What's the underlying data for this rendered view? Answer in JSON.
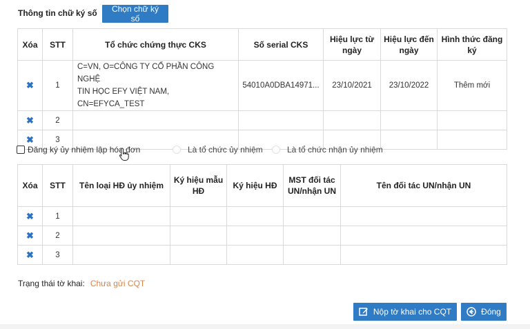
{
  "signature_section": {
    "title": "Thông tin chữ ký số",
    "choose_button": "Chọn chữ ký số",
    "headers": [
      "Xóa",
      "STT",
      "Tổ chức chứng thực CKS",
      "Số serial CKS",
      "Hiệu lực từ ngày",
      "Hiệu lực đến ngày",
      "Hình thức đăng ký"
    ],
    "rows": [
      {
        "stt": "1",
        "org_line1": "C=VN, O=CÔNG TY CỔ PHẦN CÔNG NGHỆ",
        "org_line2": "TIN HỌC EFY VIỆT NAM, CN=EFYCA_TEST",
        "serial": "54010A0DBA14971...",
        "from": "23/10/2021",
        "to": "23/10/2022",
        "type": "Thêm mới"
      },
      {
        "stt": "2",
        "org_line1": "",
        "org_line2": "",
        "serial": "",
        "from": "",
        "to": "",
        "type": ""
      },
      {
        "stt": "3",
        "org_line1": "",
        "org_line2": "",
        "serial": "",
        "from": "",
        "to": "",
        "type": ""
      }
    ]
  },
  "options": {
    "checkbox_label": "Đăng ký ủy nhiệm lập hóa đơn",
    "radio_1": "Là tổ chức ủy nhiệm",
    "radio_2": "Là tổ chức nhận ủy nhiệm"
  },
  "delegation_section": {
    "headers": [
      "Xóa",
      "STT",
      "Tên loại HĐ ủy nhiệm",
      "Ký hiệu mẫu HĐ",
      "Ký hiệu HĐ",
      "MST đối tác UN/nhận UN",
      "Tên đối tác UN/nhận UN"
    ],
    "rows": [
      {
        "stt": "1"
      },
      {
        "stt": "2"
      },
      {
        "stt": "3"
      }
    ]
  },
  "status": {
    "label": "Trạng thái tờ khai:",
    "value": "Chưa gửi CQT"
  },
  "footer": {
    "submit_button": "Nộp tờ khai cho CQT",
    "close_button": "Đóng"
  },
  "colors": {
    "primary": "#2f7bc4",
    "status_text": "#d9834a",
    "delete_icon": "#2d72c2"
  },
  "icons": {
    "delete": "close-icon",
    "submit": "edit-icon",
    "close": "back-circle-icon"
  }
}
